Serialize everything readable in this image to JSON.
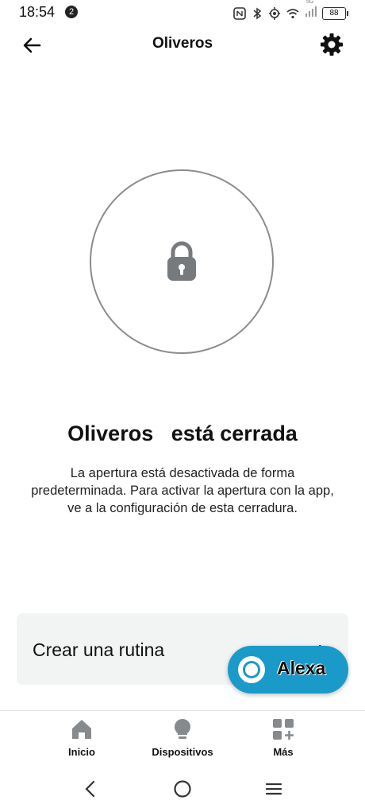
{
  "status_bar": {
    "time": "18:54",
    "notification_count": "2",
    "network_label": "5G",
    "battery": "88",
    "icons": [
      "nfc-icon",
      "bluetooth-icon",
      "location-icon",
      "wifi-icon",
      "signal-icon",
      "battery-icon"
    ]
  },
  "header": {
    "title": "Oliveros",
    "back_icon": "arrow-left-icon",
    "settings_icon": "gear-icon"
  },
  "lock": {
    "icon": "padlock-icon",
    "status_text": "Oliveros   está cerrada",
    "description": "La apertura está desactivada de forma predeterminada. Para activar la apertura con la app, ve a la configuración de esta cerradura."
  },
  "routine": {
    "label": "Crear una rutina",
    "chevron": "›"
  },
  "alexa": {
    "label": "Alexa",
    "color": "#1a9ac9"
  },
  "bottom_nav": {
    "items": [
      {
        "label": "Inicio",
        "icon": "home-icon"
      },
      {
        "label": "Dispositivos",
        "icon": "lightbulb-icon"
      },
      {
        "label": "Más",
        "icon": "more-grid-icon"
      }
    ]
  },
  "system_nav": {
    "buttons": [
      "back-nav-icon",
      "home-nav-icon",
      "menu-nav-icon"
    ]
  }
}
